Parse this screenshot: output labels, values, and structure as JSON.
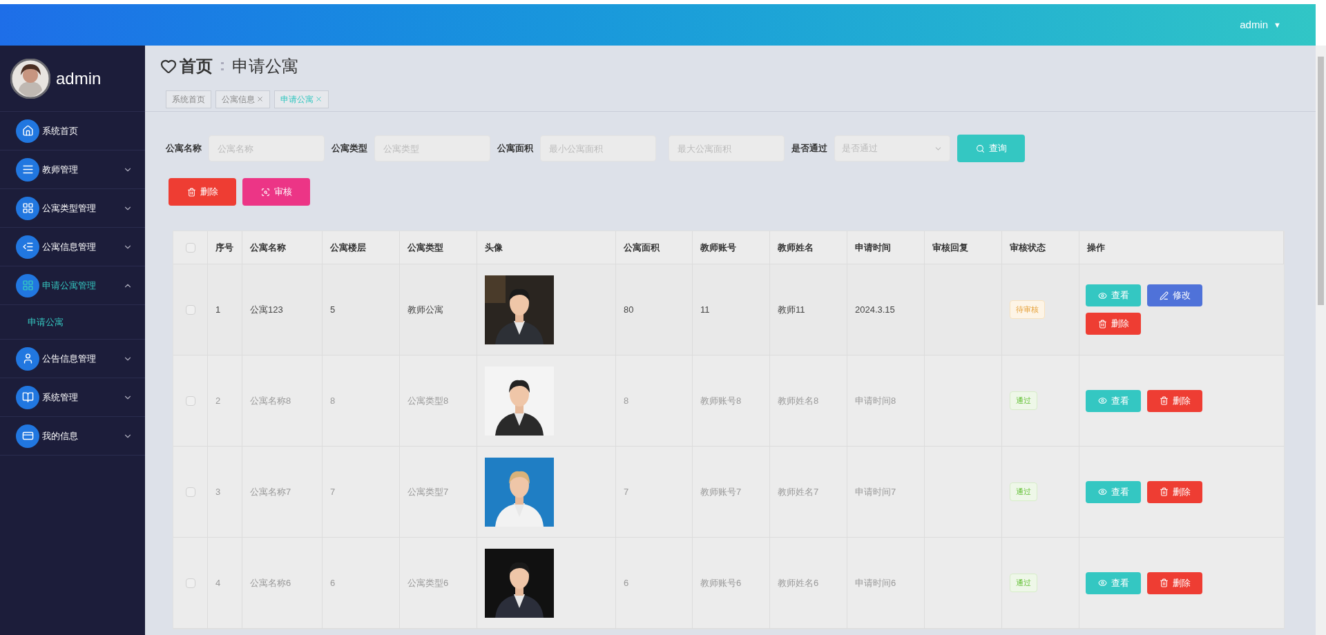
{
  "header": {
    "user": "admin",
    "caret": "▼"
  },
  "sidebar": {
    "user": "admin",
    "items": [
      {
        "label": "系统首页",
        "expandable": false,
        "selected": false
      },
      {
        "label": "教师管理",
        "expandable": true,
        "expanded": false,
        "selected": false
      },
      {
        "label": "公寓类型管理",
        "expandable": true,
        "expanded": false,
        "selected": false
      },
      {
        "label": "公寓信息管理",
        "expandable": true,
        "expanded": false,
        "selected": false
      },
      {
        "label": "申请公寓管理",
        "expandable": true,
        "expanded": true,
        "selected": true,
        "children": [
          {
            "label": "申请公寓",
            "selected": true
          }
        ]
      },
      {
        "label": "公告信息管理",
        "expandable": true,
        "expanded": false,
        "selected": false
      },
      {
        "label": "系统管理",
        "expandable": true,
        "expanded": false,
        "selected": false
      },
      {
        "label": "我的信息",
        "expandable": true,
        "expanded": false,
        "selected": false
      }
    ]
  },
  "breadcrumb": {
    "home": "首页",
    "current": "申请公寓"
  },
  "tabs": [
    {
      "label": "系统首页",
      "closable": false,
      "selected": false
    },
    {
      "label": "公寓信息",
      "closable": true,
      "selected": false
    },
    {
      "label": "申请公寓",
      "closable": true,
      "selected": true
    }
  ],
  "filters": [
    {
      "label": "公寓名称",
      "fields": [
        {
          "placeholder": "公寓名称",
          "kind": "input"
        }
      ]
    },
    {
      "label": "公寓类型",
      "fields": [
        {
          "placeholder": "公寓类型",
          "kind": "input"
        }
      ]
    },
    {
      "label": "公寓面积",
      "fields": [
        {
          "placeholder": "最小公寓面积",
          "kind": "input"
        },
        {
          "placeholder": "最大公寓面积",
          "kind": "input"
        }
      ]
    },
    {
      "label": "是否通过",
      "fields": [
        {
          "placeholder": "是否通过",
          "kind": "select"
        }
      ]
    }
  ],
  "search_button": "查询",
  "actions": [
    {
      "label": "删除",
      "kind": "delete"
    },
    {
      "label": "审核",
      "kind": "review"
    }
  ],
  "table": {
    "select_all_checked": false,
    "columns": [
      "序号",
      "公寓名称",
      "公寓楼层",
      "公寓类型",
      "头像",
      "公寓面积",
      "教师账号",
      "教师姓名",
      "申请时间",
      "审核回复",
      "审核状态",
      "操作"
    ],
    "rows": [
      {
        "checked": false,
        "hovered": true,
        "cells": [
          "1",
          "公寓123",
          "5",
          "教师公寓",
          {
            "kind": "picture"
          },
          "80",
          "11",
          "教师11",
          "2024.3.15",
          "",
          {
            "kind": "pending",
            "label": "待审核"
          },
          {
            "kind": "buttons",
            "buttons": [
              {
                "label": "查看",
                "kind": "view"
              },
              {
                "label": "修改",
                "kind": "edit"
              },
              {
                "label": "删除",
                "kind": "delete"
              }
            ]
          }
        ]
      },
      {
        "checked": false,
        "hovered": false,
        "cells": [
          "2",
          "公寓名称8",
          "8",
          "公寓类型8",
          {
            "kind": "picture"
          },
          "8",
          "教师账号8",
          "教师姓名8",
          "申请时间8",
          "",
          {
            "kind": "approved",
            "label": "通过"
          },
          {
            "kind": "buttons",
            "buttons": [
              {
                "label": "查看",
                "kind": "view"
              },
              {
                "label": "删除",
                "kind": "delete"
              }
            ]
          }
        ]
      },
      {
        "checked": false,
        "hovered": false,
        "cells": [
          "3",
          "公寓名称7",
          "7",
          "公寓类型7",
          {
            "kind": "picture"
          },
          "7",
          "教师账号7",
          "教师姓名7",
          "申请时间7",
          "",
          {
            "kind": "approved",
            "label": "通过"
          },
          {
            "kind": "buttons",
            "buttons": [
              {
                "label": "查看",
                "kind": "view"
              },
              {
                "label": "删除",
                "kind": "delete"
              }
            ]
          }
        ]
      },
      {
        "checked": false,
        "hovered": false,
        "cells": [
          "4",
          "公寓名称6",
          "6",
          "公寓类型6",
          {
            "kind": "picture"
          },
          "6",
          "教师账号6",
          "教师姓名6",
          "申请时间6",
          "",
          {
            "kind": "approved",
            "label": "通过"
          },
          {
            "kind": "buttons",
            "buttons": [
              {
                "label": "查看",
                "kind": "view"
              },
              {
                "label": "删除",
                "kind": "delete"
              }
            ]
          }
        ]
      }
    ]
  }
}
